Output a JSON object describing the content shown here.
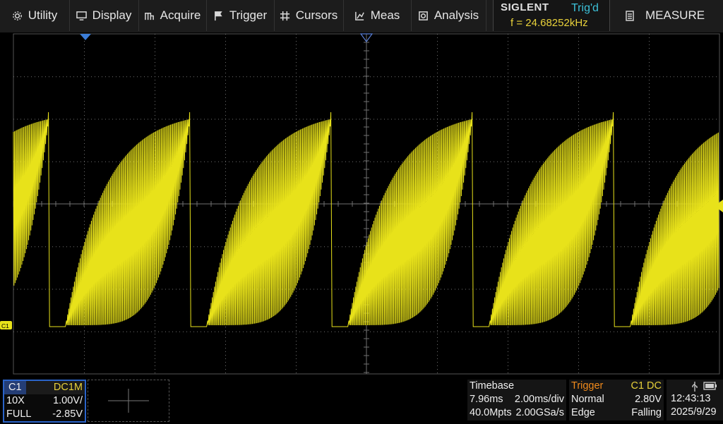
{
  "menu": {
    "items": [
      {
        "label": "Utility",
        "icon": "gear-icon"
      },
      {
        "label": "Display",
        "icon": "monitor-icon"
      },
      {
        "label": "Acquire",
        "icon": "acquire-icon"
      },
      {
        "label": "Trigger",
        "icon": "flag-icon"
      },
      {
        "label": "Cursors",
        "icon": "crosshair-icon"
      },
      {
        "label": "Meas",
        "icon": "chart-icon"
      },
      {
        "label": "Analysis",
        "icon": "analysis-icon"
      }
    ],
    "brand": "SIGLENT",
    "trig_status": "Trig'd",
    "frequency": "f = 24.68252kHz",
    "measure_label": "MEASURE"
  },
  "screen": {
    "channel_marker": "C1",
    "colors": {
      "trace": "#e8e21a",
      "grid": "#707070",
      "trigger_marker": "#3b7dd8"
    }
  },
  "channel1": {
    "name": "C1",
    "coupling": "DC1M",
    "probe": "10X",
    "scale": "1.00V/",
    "bandwidth": "FULL",
    "offset": "-2.85V"
  },
  "timebase": {
    "title": "Timebase",
    "delay": "7.96ms",
    "scale": "2.00ms/div",
    "memory": "40.0Mpts",
    "sample_rate": "2.00GSa/s"
  },
  "trigger": {
    "title": "Trigger",
    "source": "C1 DC",
    "mode": "Normal",
    "level": "2.80V",
    "type": "Edge",
    "slope": "Falling"
  },
  "clock": {
    "time": "12:43:13",
    "date": "2025/9/29",
    "usb_icon": "usb-icon",
    "power_icon": "battery-icon"
  }
}
